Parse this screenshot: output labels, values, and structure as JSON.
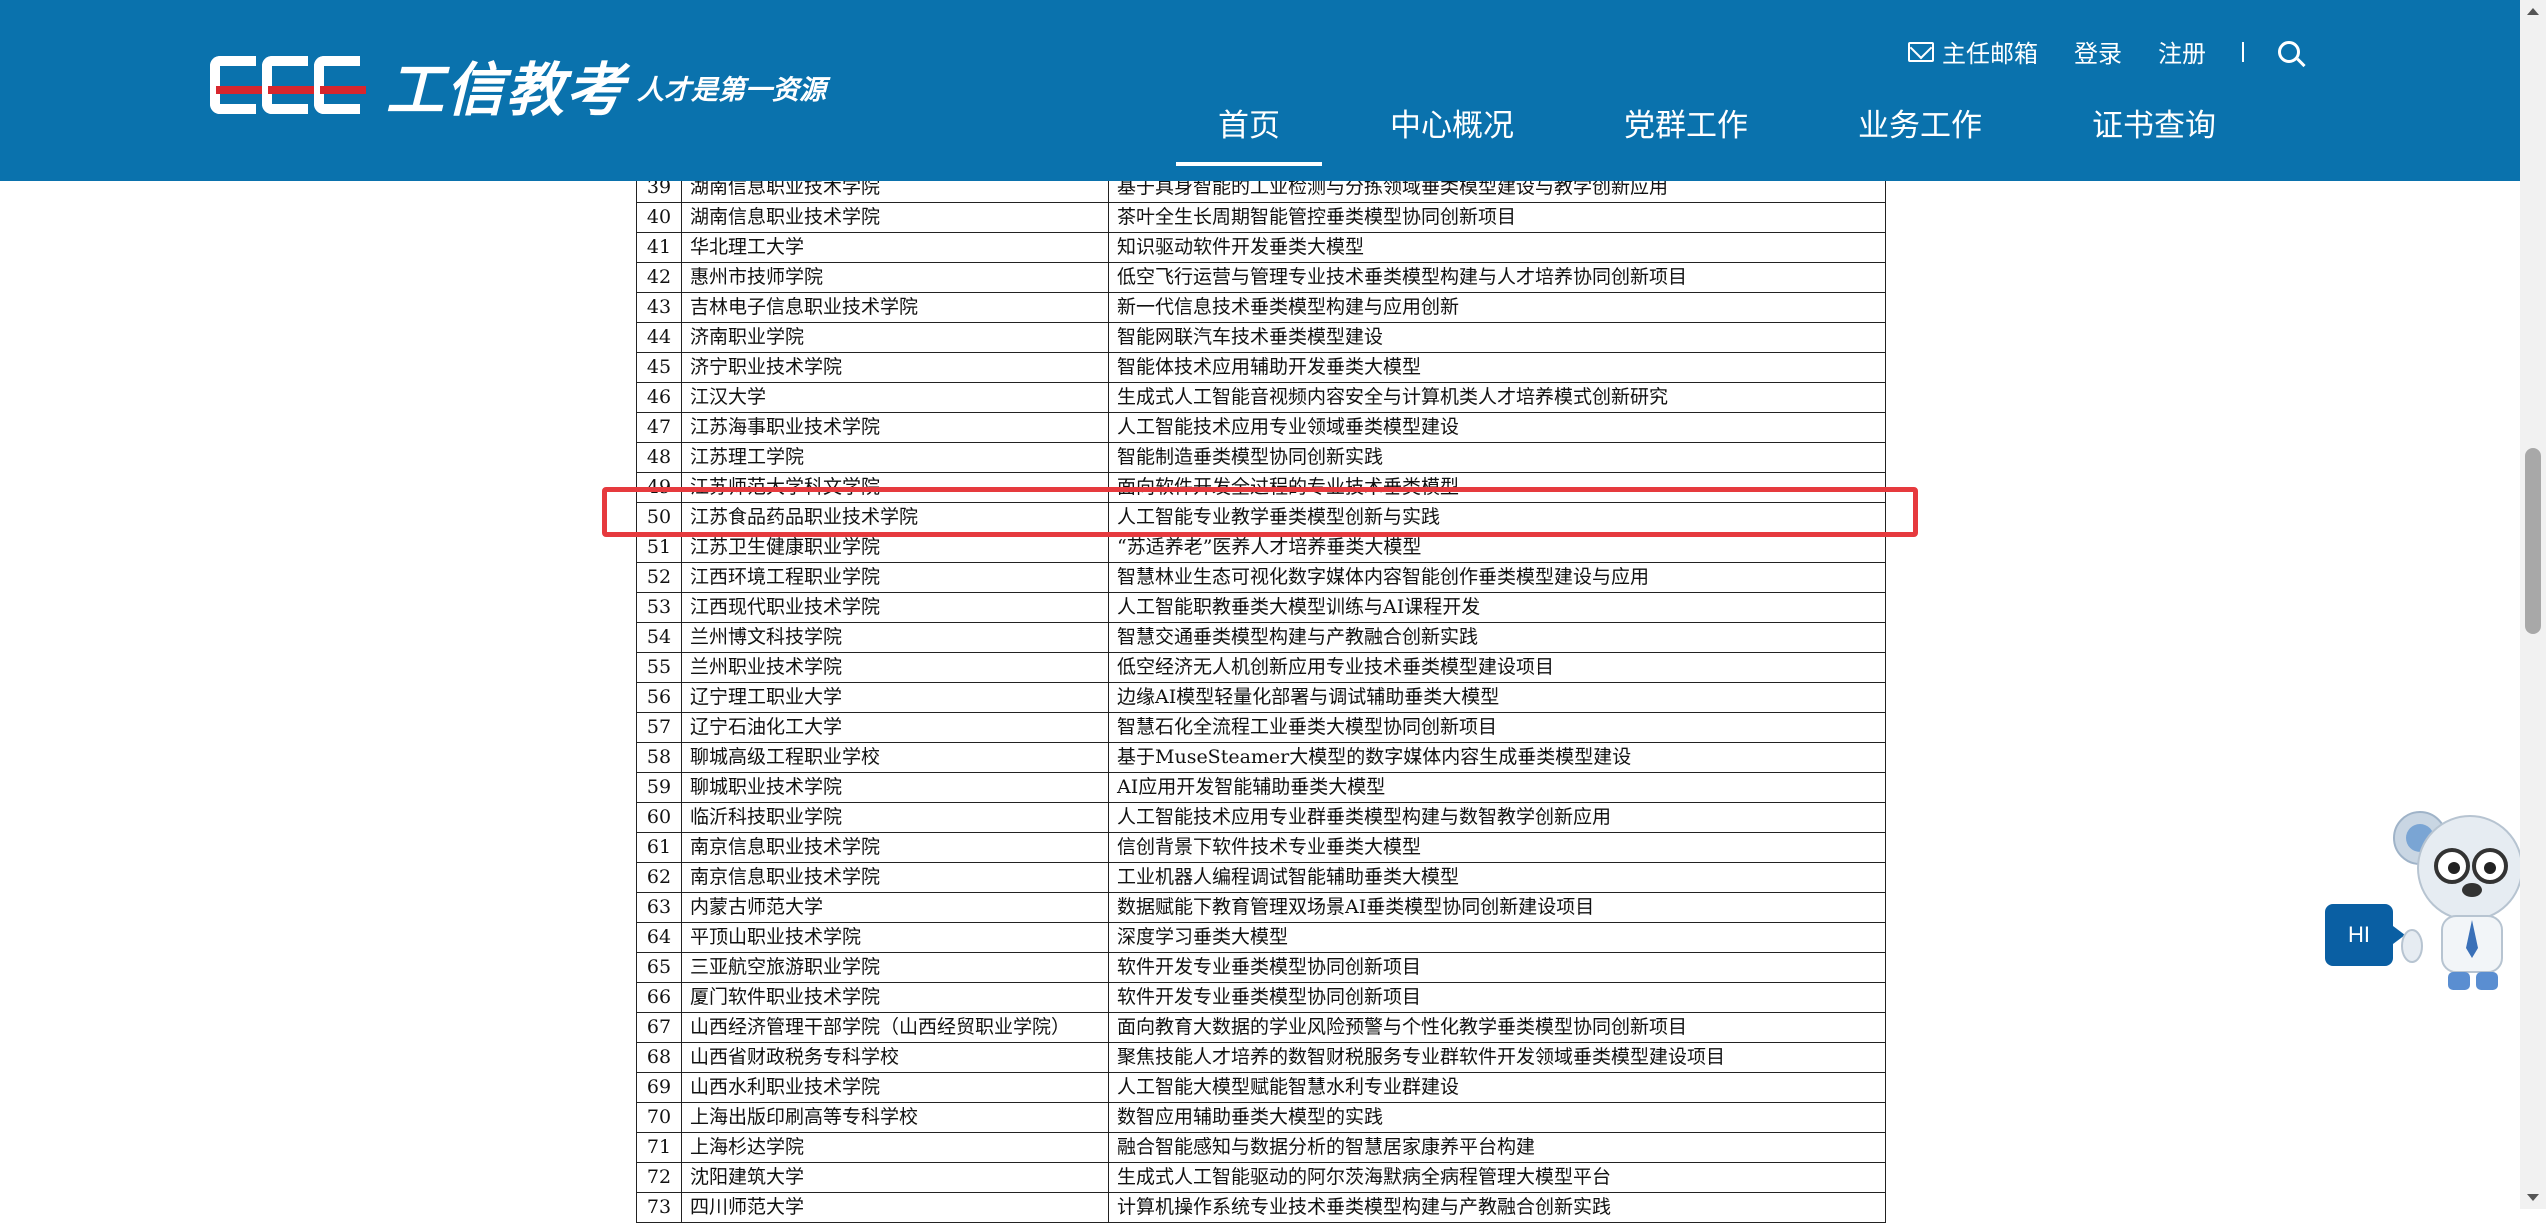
{
  "header": {
    "logo_mark": "CEC",
    "logo_text": "工信教考",
    "slogan": "人才是第一资源",
    "top_links": {
      "mailbox": "主任邮箱",
      "login": "登录",
      "register": "注册",
      "separator": "|"
    },
    "nav": [
      {
        "label": "首页",
        "active": true
      },
      {
        "label": "中心概况",
        "active": false
      },
      {
        "label": "党群工作",
        "active": false
      },
      {
        "label": "业务工作",
        "active": false
      },
      {
        "label": "证书查询",
        "active": false
      }
    ],
    "bg_color": "#0a72ad"
  },
  "table": {
    "rows": [
      {
        "no": "39",
        "school": "湖南信息职业技术学院",
        "project": "基于具身智能的工业检测与分拣领域垂类模型建设与教学创新应用"
      },
      {
        "no": "40",
        "school": "湖南信息职业技术学院",
        "project": "茶叶全生长周期智能管控垂类模型协同创新项目"
      },
      {
        "no": "41",
        "school": "华北理工大学",
        "project": "知识驱动软件开发垂类大模型"
      },
      {
        "no": "42",
        "school": "惠州市技师学院",
        "project": "低空飞行运营与管理专业技术垂类模型构建与人才培养协同创新项目"
      },
      {
        "no": "43",
        "school": "吉林电子信息职业技术学院",
        "project": "新一代信息技术垂类模型构建与应用创新"
      },
      {
        "no": "44",
        "school": "济南职业学院",
        "project": "智能网联汽车技术垂类模型建设"
      },
      {
        "no": "45",
        "school": "济宁职业技术学院",
        "project": "智能体技术应用辅助开发垂类大模型"
      },
      {
        "no": "46",
        "school": "江汉大学",
        "project": "生成式人工智能音视频内容安全与计算机类人才培养模式创新研究"
      },
      {
        "no": "47",
        "school": "江苏海事职业技术学院",
        "project": "人工智能技术应用专业领域垂类模型建设"
      },
      {
        "no": "48",
        "school": "江苏理工学院",
        "project": "智能制造垂类模型协同创新实践"
      },
      {
        "no": "49",
        "school": "江苏师范大学科文学院",
        "project": "面向软件开发全过程的专业技术垂类模型"
      },
      {
        "no": "50",
        "school": "江苏食品药品职业技术学院",
        "project": "人工智能专业教学垂类模型创新与实践"
      },
      {
        "no": "51",
        "school": "江苏卫生健康职业学院",
        "project": "“苏适养老”医养人才培养垂类大模型"
      },
      {
        "no": "52",
        "school": "江西环境工程职业学院",
        "project": "智慧林业生态可视化数字媒体内容智能创作垂类模型建设与应用"
      },
      {
        "no": "53",
        "school": "江西现代职业技术学院",
        "project": "人工智能职教垂类大模型训练与AI课程开发"
      },
      {
        "no": "54",
        "school": "兰州博文科技学院",
        "project": "智慧交通垂类模型构建与产教融合创新实践"
      },
      {
        "no": "55",
        "school": "兰州职业技术学院",
        "project": "低空经济无人机创新应用专业技术垂类模型建设项目"
      },
      {
        "no": "56",
        "school": "辽宁理工职业大学",
        "project": "边缘AI模型轻量化部署与调试辅助垂类大模型"
      },
      {
        "no": "57",
        "school": "辽宁石油化工大学",
        "project": "智慧石化全流程工业垂类大模型协同创新项目"
      },
      {
        "no": "58",
        "school": "聊城高级工程职业学校",
        "project": "基于MuseSteamer大模型的数字媒体内容生成垂类模型建设"
      },
      {
        "no": "59",
        "school": "聊城职业技术学院",
        "project": "AI应用开发智能辅助垂类大模型"
      },
      {
        "no": "60",
        "school": "临沂科技职业学院",
        "project": "人工智能技术应用专业群垂类模型构建与数智教学创新应用"
      },
      {
        "no": "61",
        "school": "南京信息职业技术学院",
        "project": "信创背景下软件技术专业垂类大模型"
      },
      {
        "no": "62",
        "school": "南京信息职业技术学院",
        "project": "工业机器人编程调试智能辅助垂类大模型"
      },
      {
        "no": "63",
        "school": "内蒙古师范大学",
        "project": "数据赋能下教育管理双场景AI垂类模型协同创新建设项目"
      },
      {
        "no": "64",
        "school": "平顶山职业技术学院",
        "project": "深度学习垂类大模型"
      },
      {
        "no": "65",
        "school": "三亚航空旅游职业学院",
        "project": "软件开发专业垂类模型协同创新项目"
      },
      {
        "no": "66",
        "school": "厦门软件职业技术学院",
        "project": "软件开发专业垂类模型协同创新项目"
      },
      {
        "no": "67",
        "school": "山西经济管理干部学院（山西经贸职业学院）",
        "project": "面向教育大数据的学业风险预警与个性化教学垂类模型协同创新项目"
      },
      {
        "no": "68",
        "school": "山西省财政税务专科学校",
        "project": "聚焦技能人才培养的数智财税服务专业群软件开发领域垂类模型建设项目"
      },
      {
        "no": "69",
        "school": "山西水利职业技术学院",
        "project": "人工智能大模型赋能智慧水利专业群建设"
      },
      {
        "no": "70",
        "school": "上海出版印刷高等专科学校",
        "project": "数智应用辅助垂类大模型的实践"
      },
      {
        "no": "71",
        "school": "上海杉达学院",
        "project": "融合智能感知与数据分析的智慧居家康养平台构建"
      },
      {
        "no": "72",
        "school": "沈阳建筑大学",
        "project": "生成式人工智能驱动的阿尔茨海默病全病程管理大模型平台"
      },
      {
        "no": "73",
        "school": "四川师范大学",
        "project": "计算机操作系统专业技术垂类模型构建与产教融合创新实践"
      }
    ],
    "highlighted_row": "50",
    "highlight_color": "#e63a3e"
  },
  "assistant": {
    "bubble_text": "HI"
  }
}
